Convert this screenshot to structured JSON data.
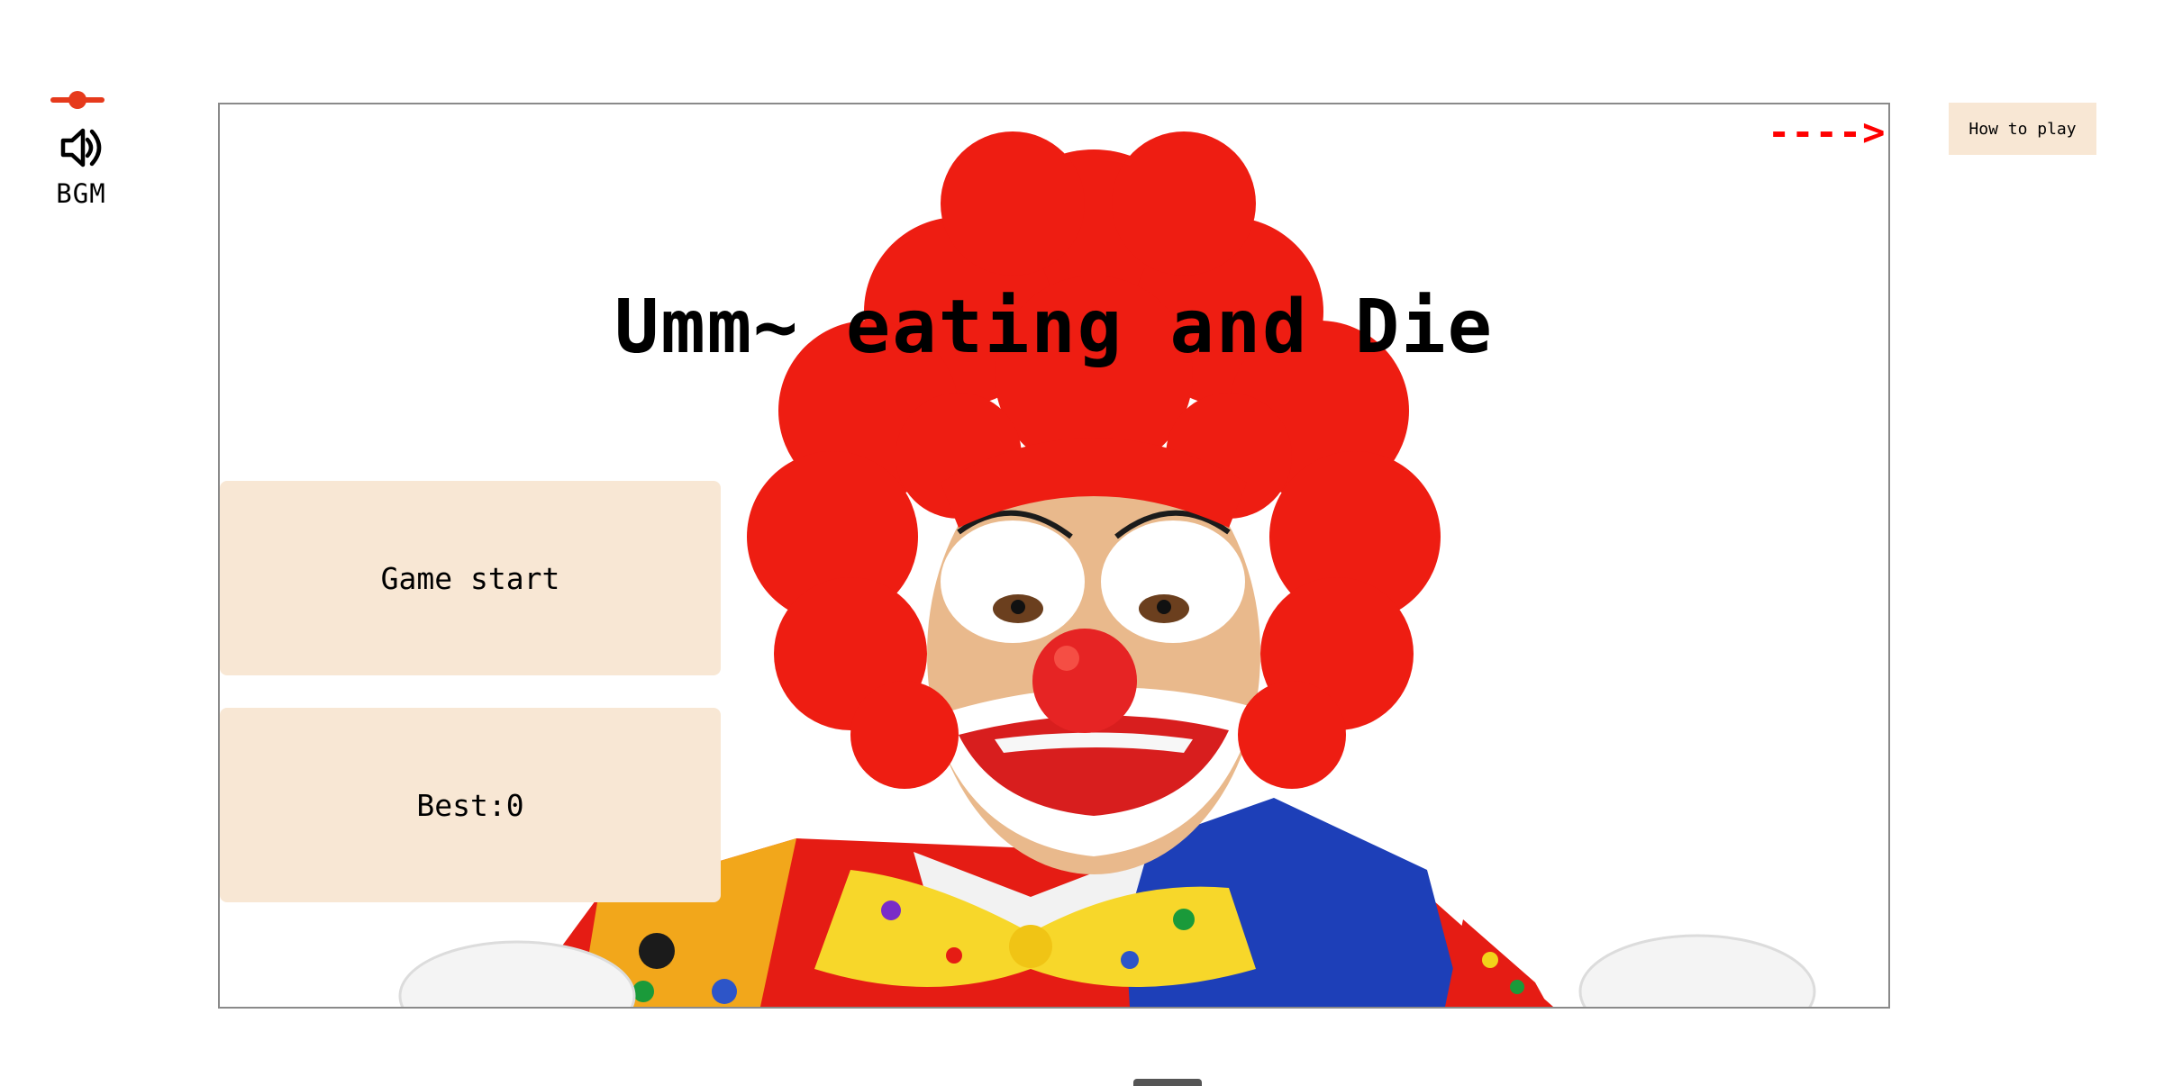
{
  "bgm": {
    "label": "BGM",
    "volume": 0.5,
    "accent_color": "#e63a1c",
    "icon": "speaker-icon"
  },
  "game": {
    "title": "Umm~ eating and Die",
    "arrow_hint": "---->",
    "arrow_color": "#ff0000",
    "start_label": "Game start",
    "best_label": "Best:0",
    "button_color": "#f8e7d4",
    "background_image": "clown-image"
  },
  "howto": {
    "label": "How to play"
  }
}
